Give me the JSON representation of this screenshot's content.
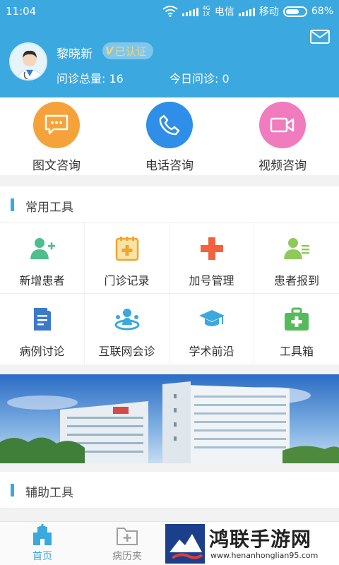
{
  "status_bar": {
    "time": "11:04",
    "net_top": "4G",
    "net_bottom": "1X",
    "carrier1": "电信",
    "carrier2": "移动",
    "battery": "68%"
  },
  "header": {
    "doctor_name": "黎晓新",
    "verified_label": "已认证",
    "total_label": "问诊总量: 16",
    "today_label": "今日问诊: 0"
  },
  "consult": [
    {
      "label": "图文咨询",
      "color": "#f6a23a",
      "icon": "chat-bubble-icon"
    },
    {
      "label": "电话咨询",
      "color": "#2f8ee8",
      "icon": "phone-icon"
    },
    {
      "label": "视频咨询",
      "color": "#f07bbd",
      "icon": "video-icon"
    }
  ],
  "common_tools": {
    "title": "常用工具",
    "items": [
      {
        "label": "新增患者",
        "icon": "add-patient-icon"
      },
      {
        "label": "门诊记录",
        "icon": "clinic-record-icon"
      },
      {
        "label": "加号管理",
        "icon": "plus-icon"
      },
      {
        "label": "患者报到",
        "icon": "patient-checkin-icon"
      },
      {
        "label": "病例讨论",
        "icon": "case-document-icon"
      },
      {
        "label": "互联网会诊",
        "icon": "online-consultation-icon"
      },
      {
        "label": "学术前沿",
        "icon": "graduation-cap-icon"
      },
      {
        "label": "工具箱",
        "icon": "toolbox-icon"
      }
    ]
  },
  "assist_tools": {
    "title": "辅助工具"
  },
  "bottom_nav": [
    {
      "label": "首页",
      "active": true
    },
    {
      "label": "病历夹",
      "active": false
    }
  ],
  "watermark": {
    "title": "鸿联手游网",
    "url": "www.henanhonglian95.com"
  },
  "colors": {
    "primary": "#3ba8e0",
    "green": "#4cbf8a",
    "orange": "#f6a23a",
    "red": "#f2623f"
  }
}
